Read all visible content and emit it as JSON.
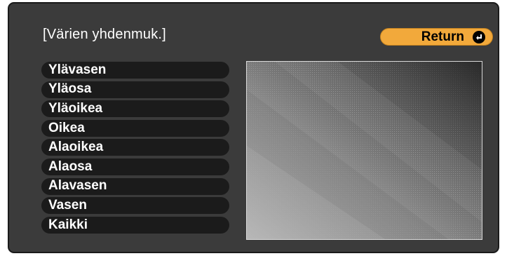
{
  "screen": {
    "title": "[Värien yhdenmuk.]"
  },
  "return_button": {
    "label": "Return",
    "icon": "enter-icon"
  },
  "menu": {
    "items": [
      {
        "label": "Ylävasen"
      },
      {
        "label": "Yläosa"
      },
      {
        "label": "Yläoikea"
      },
      {
        "label": "Oikea"
      },
      {
        "label": "Alaoikea"
      },
      {
        "label": "Alaosa"
      },
      {
        "label": "Alavasen"
      },
      {
        "label": "Vasen"
      },
      {
        "label": "Kaikki"
      }
    ]
  },
  "colors": {
    "panel_background": "#3b3b3b",
    "return_button": "#f2a93b",
    "menu_item": "#1b1b1b",
    "text": "#ffffff"
  }
}
